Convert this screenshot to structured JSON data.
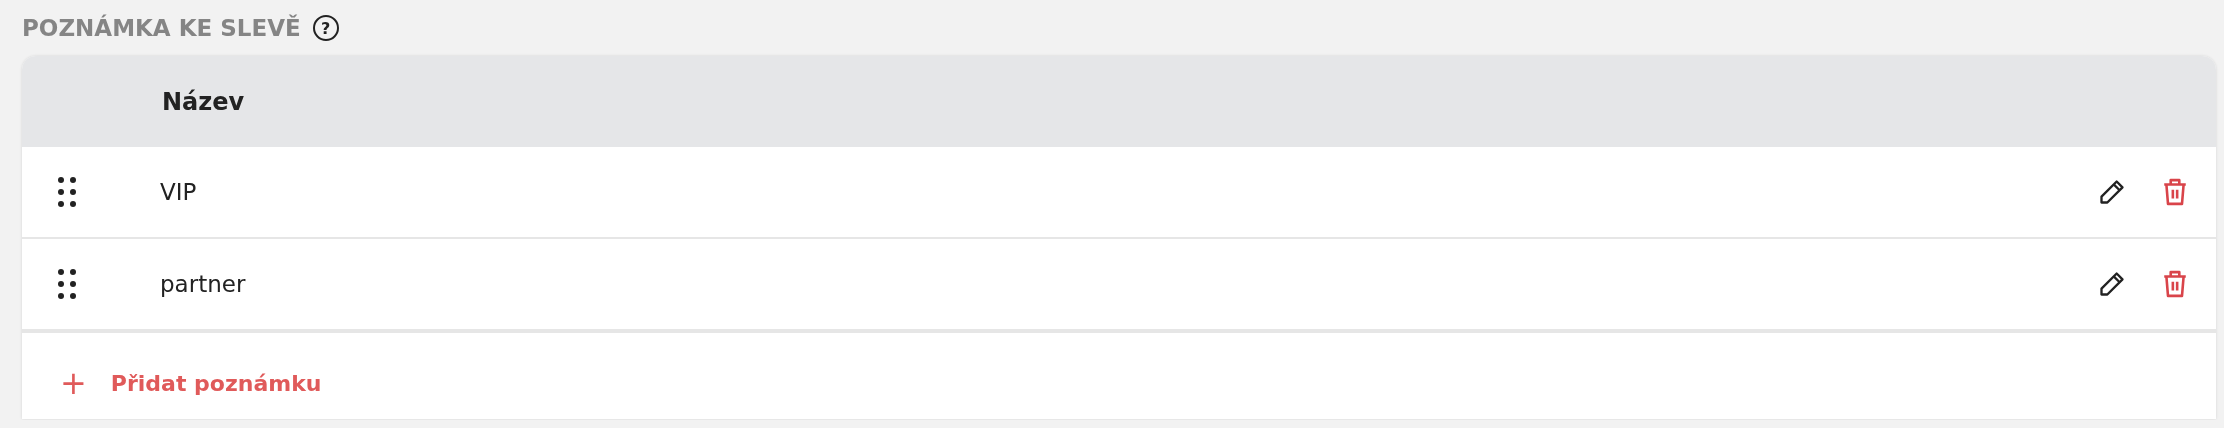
{
  "section": {
    "title": "POZNÁMKA KE SLEVĚ",
    "help": "?"
  },
  "table": {
    "columns": [
      "Název"
    ],
    "rows": [
      {
        "name": "VIP"
      },
      {
        "name": "partner"
      }
    ]
  },
  "add_button": {
    "icon": "+",
    "label": "Přidat poznámku"
  }
}
